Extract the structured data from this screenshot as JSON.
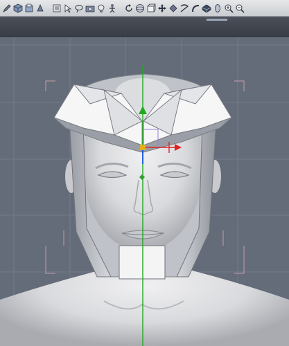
{
  "toolbar": {
    "tools": [
      {
        "name": "edit-icon"
      },
      {
        "name": "cube-icon"
      },
      {
        "name": "open-icon"
      },
      {
        "name": "paint-icon"
      },
      {
        "name": "list-icon"
      },
      {
        "name": "select-icon"
      },
      {
        "name": "lasso-icon"
      },
      {
        "name": "camera-icon"
      },
      {
        "name": "light-icon"
      },
      {
        "name": "pose-icon"
      },
      {
        "name": "rotate-icon"
      },
      {
        "name": "sphere-icon"
      },
      {
        "name": "box-icon"
      },
      {
        "name": "move-icon"
      },
      {
        "name": "scale-icon"
      },
      {
        "name": "twist-icon"
      },
      {
        "name": "bend-icon"
      },
      {
        "name": "smooth-icon"
      },
      {
        "name": "shape-icon"
      },
      {
        "name": "zoom-in-icon"
      },
      {
        "name": "zoom-out-icon"
      }
    ]
  },
  "viewport": {
    "accent": "#2f9e2f",
    "manipulator_colors": {
      "y_axis": "#1faa1f",
      "x_axis": "#e02020",
      "z_axis": "#2060e0"
    }
  }
}
